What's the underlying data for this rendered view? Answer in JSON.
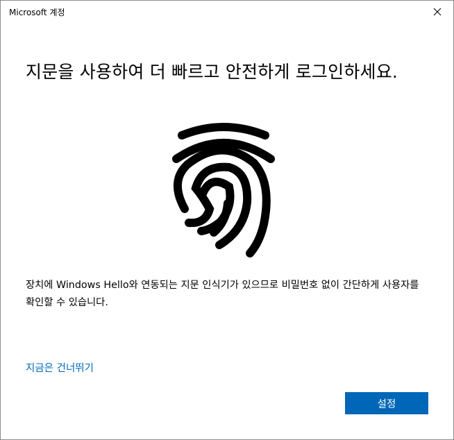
{
  "window": {
    "title": "Microsoft 계정"
  },
  "main": {
    "heading": "지문을 사용하여 더 빠르고 안전하게 로그인하세요.",
    "description": "장치에 Windows Hello와 연동되는 지문 인식기가 있으므로 비밀번호 없이 간단하게 사용자를 확인할 수 있습니다.",
    "skip_link": "지금은 건너뛰기",
    "setup_button": "설정"
  },
  "icons": {
    "close": "close-icon",
    "fingerprint": "fingerprint-icon"
  },
  "colors": {
    "accent": "#0067b8",
    "button_text": "#ffffff",
    "text": "#000000"
  }
}
